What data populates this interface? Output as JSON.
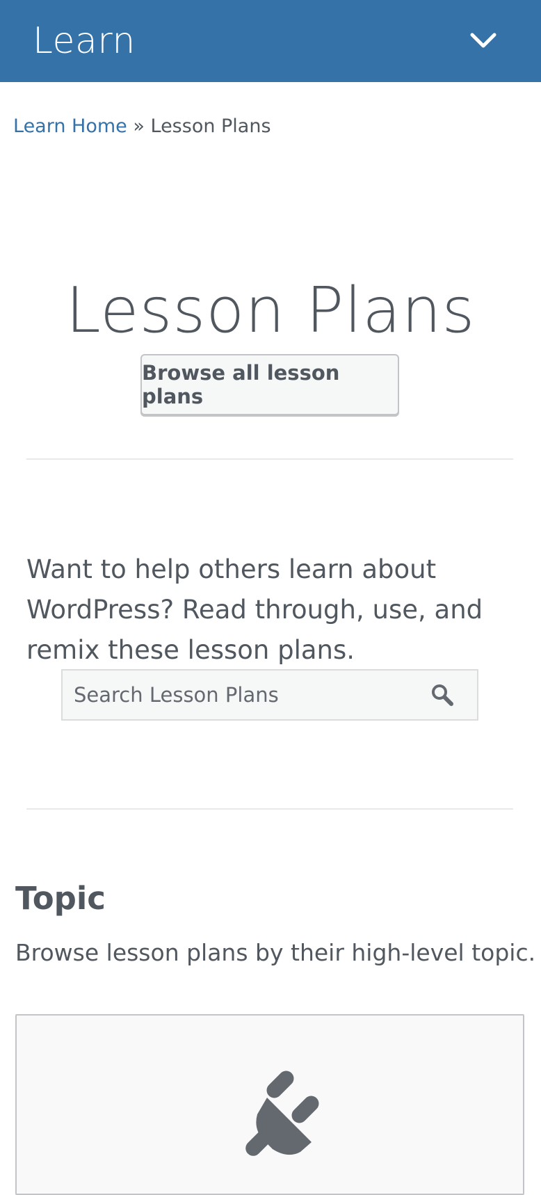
{
  "header": {
    "title": "Learn",
    "toggle_icon": "chevron-down-icon",
    "background": "#3572a8"
  },
  "breadcrumb": {
    "home_label": "Learn Home",
    "separator": "»",
    "current": "Lesson Plans"
  },
  "hero": {
    "title": "Lesson Plans",
    "browse_button_label": "Browse all lesson plans"
  },
  "intro": {
    "text": "Want to help others learn about WordPress? Read through, use, and remix these lesson plans."
  },
  "search": {
    "placeholder": "Search Lesson Plans",
    "value": "",
    "icon": "search-icon"
  },
  "topic_section": {
    "title": "Topic",
    "description": "Browse lesson plans by their high-level topic.",
    "cards": [
      {
        "icon": "plugin-icon"
      }
    ]
  },
  "colors": {
    "accent": "#3572a8",
    "text": "#50575e",
    "icon": "#646970"
  }
}
